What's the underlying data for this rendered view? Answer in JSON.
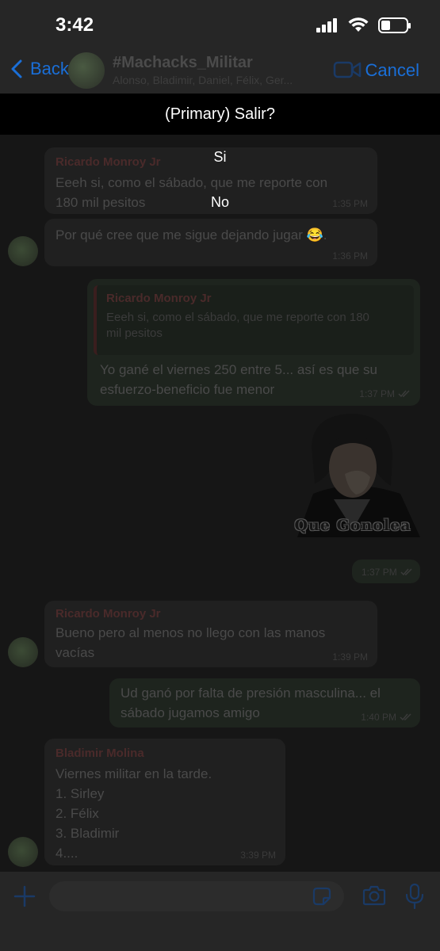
{
  "status_bar": {
    "time": "3:42"
  },
  "nav": {
    "back_label": "Back",
    "group_name": "#Machacks_Militar",
    "members": "Alonso, Bladimir, Daniel, Félix, Ger...",
    "cancel_label": "Cancel"
  },
  "action_sheet": {
    "title": "(Primary) Salir?",
    "options": [
      "Si",
      "No"
    ]
  },
  "messages": [
    {
      "sender": "Ricardo Monroy Jr",
      "lines": [
        "Eeeh si, como el sábado, que me reporte con",
        "180 mil pesitos"
      ],
      "time": "1:35 PM"
    },
    {
      "text": "Por qué cree que me sigue dejando jugar 😂.",
      "time": "1:36 PM"
    },
    {
      "quote_sender": "Ricardo Monroy Jr",
      "quote_lines": [
        "Eeeh si, como el sábado, que me reporte con 180",
        "mil pesitos"
      ],
      "lines": [
        "Yo gané el viernes 250 entre 5... así es que su",
        "esfuerzo-beneficio fue menor"
      ],
      "time": "1:37 PM"
    },
    {
      "sticker_caption": "Que Gonolea",
      "time": "1:37 PM"
    },
    {
      "sender": "Ricardo Monroy Jr",
      "lines": [
        "Bueno pero al menos no llego con las manos",
        "vacías"
      ],
      "time": "1:39 PM"
    },
    {
      "lines": [
        "Ud ganó por falta de presión masculina... el",
        "sábado jugamos amigo"
      ],
      "time": "1:40 PM"
    },
    {
      "sender": "Bladimir Molina",
      "lines": [
        "Viernes militar en la tarde.",
        "1. Sirley",
        "2. Félix",
        "3. Bladimir",
        "4...."
      ],
      "time": "3:39 PM"
    }
  ],
  "colors": {
    "accent": "#1a6fd8",
    "sheet_bg": "#000000",
    "dim_bubble": "#202020"
  }
}
